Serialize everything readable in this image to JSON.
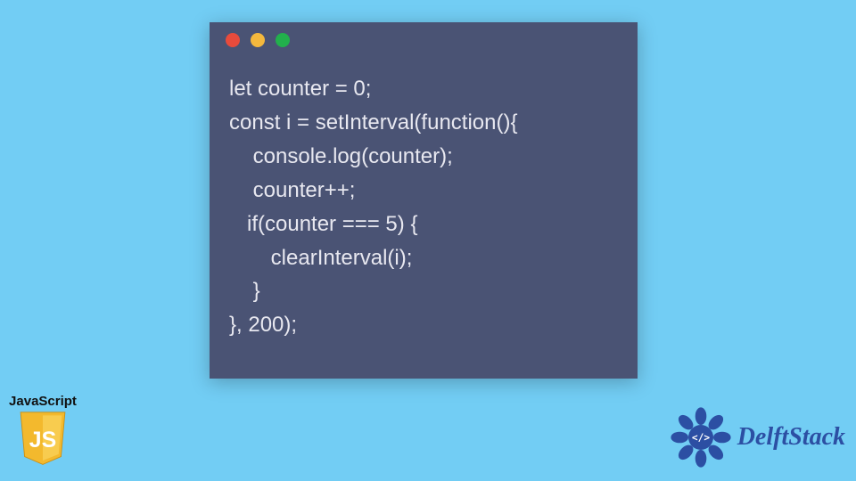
{
  "code": {
    "language": "JavaScript",
    "lines": [
      "let counter = 0;",
      "const i = setInterval(function(){",
      "    console.log(counter);",
      "    counter++;",
      "   if(counter === 5) {",
      "       clearInterval(i);",
      "    }",
      "}, 200);"
    ]
  },
  "window": {
    "dot_colors": {
      "red": "#e84b3c",
      "yellow": "#f4b83d",
      "green": "#22b04c"
    },
    "bg": "#4a5374",
    "text_color": "#e8e8f0"
  },
  "js_badge": {
    "label": "JavaScript",
    "shield_text": "JS",
    "shield_color": "#f3b92d"
  },
  "brand": {
    "name": "DelftStack",
    "icon_color": "#2c4fa3"
  },
  "page_bg": "#72cdf4"
}
